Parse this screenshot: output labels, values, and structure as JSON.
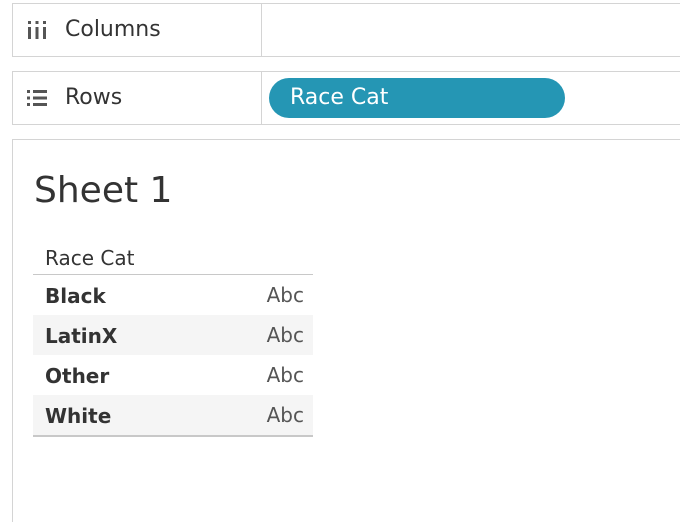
{
  "shelves": {
    "columns": {
      "label": "Columns",
      "icon": "columns-icon",
      "pills": []
    },
    "rows": {
      "label": "Rows",
      "icon": "rows-icon",
      "pills": [
        {
          "label": "Race Cat",
          "color": "#2596b4"
        }
      ]
    }
  },
  "sheet": {
    "title": "Sheet 1",
    "table": {
      "header": "Race Cat",
      "rows": [
        {
          "name": "Black",
          "value": "Abc"
        },
        {
          "name": "LatinX",
          "value": "Abc"
        },
        {
          "name": "Other",
          "value": "Abc"
        },
        {
          "name": "White",
          "value": "Abc"
        }
      ]
    }
  },
  "colors": {
    "pill": "#2596b4",
    "border": "#d4d4d4",
    "text": "#333333"
  }
}
